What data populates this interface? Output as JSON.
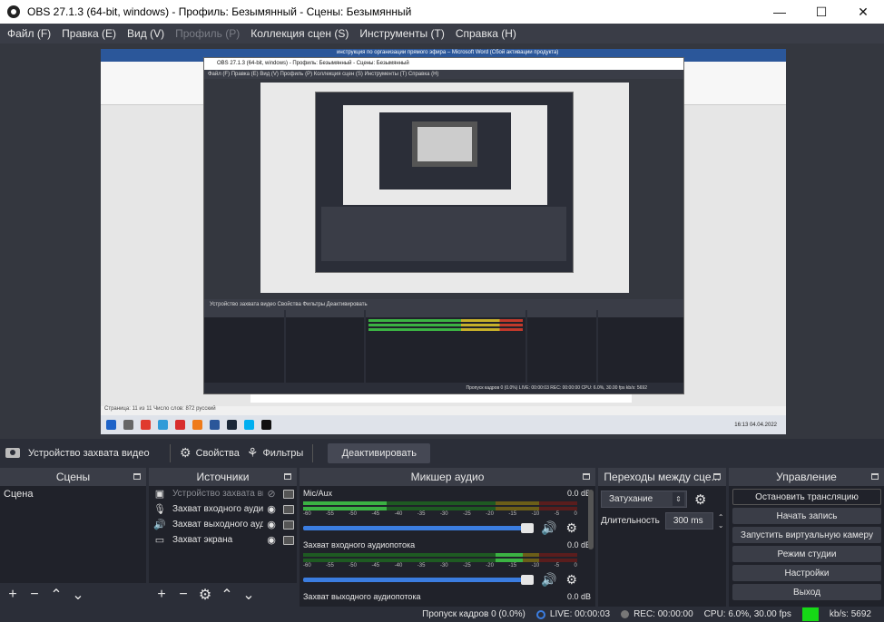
{
  "window": {
    "title": "OBS 27.1.3 (64-bit, windows) - Профиль: Безымянный - Сцены: Безымянный",
    "controls": {
      "minimize": "—",
      "maximize": "☐",
      "close": "✕"
    }
  },
  "menu": [
    {
      "label": "Файл (F)",
      "disabled": false
    },
    {
      "label": "Правка (E)",
      "disabled": false
    },
    {
      "label": "Вид (V)",
      "disabled": false
    },
    {
      "label": "Профиль (P)",
      "disabled": true
    },
    {
      "label": "Коллекция сцен (S)",
      "disabled": false
    },
    {
      "label": "Инструменты (T)",
      "disabled": false
    },
    {
      "label": "Справка (H)",
      "disabled": false
    }
  ],
  "preview": {
    "word_title": "инструкция по организации прямого эфира – Microsoft Word (Сбой активации продукта)",
    "word_status": "Страница: 11 из 11   Число слов: 872   русский",
    "clock_time": "16:13",
    "clock_date": "04.04.2022",
    "inner_title": "OBS 27.1.3 (64-bit, windows) - Профиль: Безымянный - Сцены: Безымянный",
    "inner_menu": "Файл (F)   Правка (E)   Вид (V)   Профиль (P)   Коллекция сцен (S)   Инструменты (T)   Справка (H)",
    "inner_source": "Устройство захвата видео     Свойства   Фильтры   Деактивировать",
    "inner_status": "Пропуск кадров 0 (0.0%)   LIVE: 00:00:03   REC: 00:00:00   CPU: 6.0%, 30.00 fps   kb/s: 5692"
  },
  "source_toolbar": {
    "source_name": "Устройство захвата видео",
    "properties_label": "Свойства",
    "filters_label": "Фильтры",
    "deactivate_label": "Деактивировать"
  },
  "scenes": {
    "title": "Сцены",
    "items": [
      "Сцена"
    ]
  },
  "sources": {
    "title": "Источники",
    "items": [
      {
        "name": "Устройство захвата видео",
        "icon": "camera-icon",
        "visible": false
      },
      {
        "name": "Захват входного аудио",
        "icon": "microphone-icon",
        "visible": true
      },
      {
        "name": "Захват выходного аудио",
        "icon": "speaker-icon",
        "visible": true
      },
      {
        "name": "Захват экрана",
        "icon": "monitor-icon",
        "visible": true
      }
    ]
  },
  "mixer": {
    "title": "Микшер аудио",
    "ticks": [
      "-60",
      "-55",
      "-50",
      "-45",
      "-40",
      "-35",
      "-30",
      "-25",
      "-20",
      "-15",
      "-10",
      "-5",
      "0"
    ],
    "channels": [
      {
        "name": "Mic/Aux",
        "level": "0.0 dB"
      },
      {
        "name": "Захват входного аудиопотока",
        "level": "0.0 dB"
      },
      {
        "name": "Захват выходного аудиопотока",
        "level": "0.0 dB"
      }
    ]
  },
  "transitions": {
    "title": "Переходы между сце...",
    "selected": "Затухание",
    "duration_label": "Длительность",
    "duration_value": "300 ms"
  },
  "controls": {
    "title": "Управление",
    "buttons": [
      "Остановить трансляцию",
      "Начать запись",
      "Запустить виртуальную камеру",
      "Режим студии",
      "Настройки",
      "Выход"
    ]
  },
  "status": {
    "dropped": "Пропуск кадров 0 (0.0%)",
    "live": "LIVE: 00:00:03",
    "rec": "REC: 00:00:00",
    "cpu": "CPU: 6.0%, 30.00 fps",
    "kbs": "kb/s: 5692",
    "indicator_color": "#16d916"
  }
}
